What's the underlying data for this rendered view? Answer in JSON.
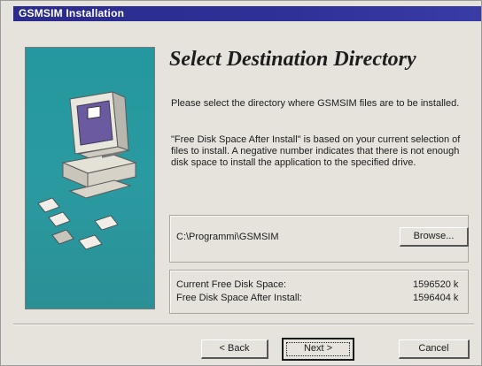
{
  "window": {
    "title": "GSMSIM Installation"
  },
  "page": {
    "heading": "Select Destination Directory",
    "paragraph1": "Please select the directory where GSMSIM files are to be installed.",
    "paragraph2": "\"Free Disk Space After Install\" is based on your current selection of files to install.  A negative number indicates that there is not enough disk space to install the application to the specified drive."
  },
  "destination": {
    "path": "C:\\Programmi\\GSMSIM",
    "browse_label": "Browse..."
  },
  "disk_space": {
    "current_label": "Current Free Disk Space:",
    "current_value": "1596520 k",
    "after_label": "Free Disk Space After Install:",
    "after_value": "1596404 k"
  },
  "buttons": {
    "back_label": "< Back",
    "next_label": "Next >",
    "cancel_label": "Cancel"
  },
  "colors": {
    "titlebar": "#2a2b8c",
    "side_panel": "#2a9aa0",
    "dialog_bg": "#e6e3dc"
  }
}
